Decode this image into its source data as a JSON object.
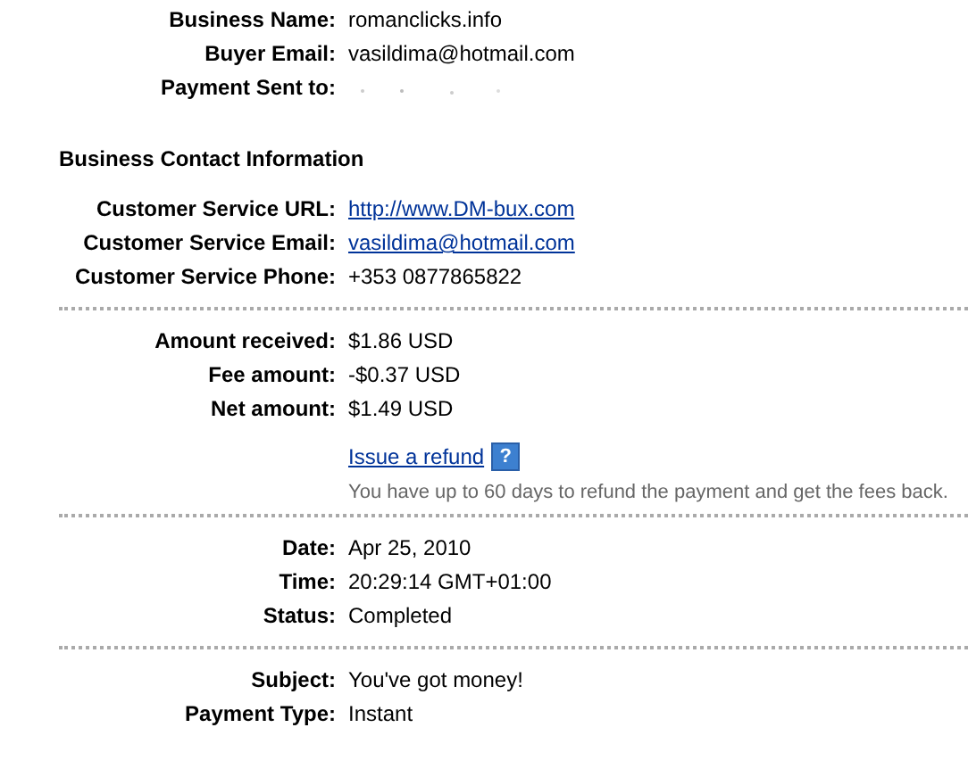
{
  "blocks": [
    {
      "kind": "section",
      "rows": [
        {
          "kind": "text",
          "label": "Business Name:",
          "value": "romanclicks.info"
        },
        {
          "kind": "text",
          "label": "Buyer Email:",
          "value": "vasildima@hotmail.com"
        },
        {
          "kind": "redacted",
          "label": "Payment Sent to:"
        }
      ]
    },
    {
      "kind": "section",
      "heading": "Business Contact Information",
      "rows": [
        {
          "kind": "link",
          "label": "Customer Service URL:",
          "value": "http://www.DM-bux.com"
        },
        {
          "kind": "link",
          "label": "Customer Service Email:",
          "value": "vasildima@hotmail.com"
        },
        {
          "kind": "text",
          "label": "Customer Service Phone:",
          "value": "+353 0877865822"
        }
      ]
    },
    {
      "kind": "divider"
    },
    {
      "kind": "section",
      "rows": [
        {
          "kind": "text",
          "label": "Amount received:",
          "value": "$1.86 USD"
        },
        {
          "kind": "text",
          "label": "Fee amount:",
          "value": "-$0.37 USD"
        },
        {
          "kind": "text",
          "label": "Net amount:",
          "value": "$1.49 USD"
        }
      ],
      "refund": {
        "link": "Issue a refund",
        "help": "?",
        "note": "You have up to 60 days to refund the payment and get the fees back."
      }
    },
    {
      "kind": "divider"
    },
    {
      "kind": "section",
      "rows": [
        {
          "kind": "text",
          "label": "Date:",
          "value": "Apr 25, 2010"
        },
        {
          "kind": "text",
          "label": "Time:",
          "value": "20:29:14 GMT+01:00"
        },
        {
          "kind": "text",
          "label": "Status:",
          "value": "Completed"
        }
      ]
    },
    {
      "kind": "divider"
    },
    {
      "kind": "section",
      "rows": [
        {
          "kind": "text",
          "label": "Subject:",
          "value": "You've got money!"
        },
        {
          "kind": "text",
          "label": "Payment Type:",
          "value": "Instant"
        }
      ]
    }
  ]
}
